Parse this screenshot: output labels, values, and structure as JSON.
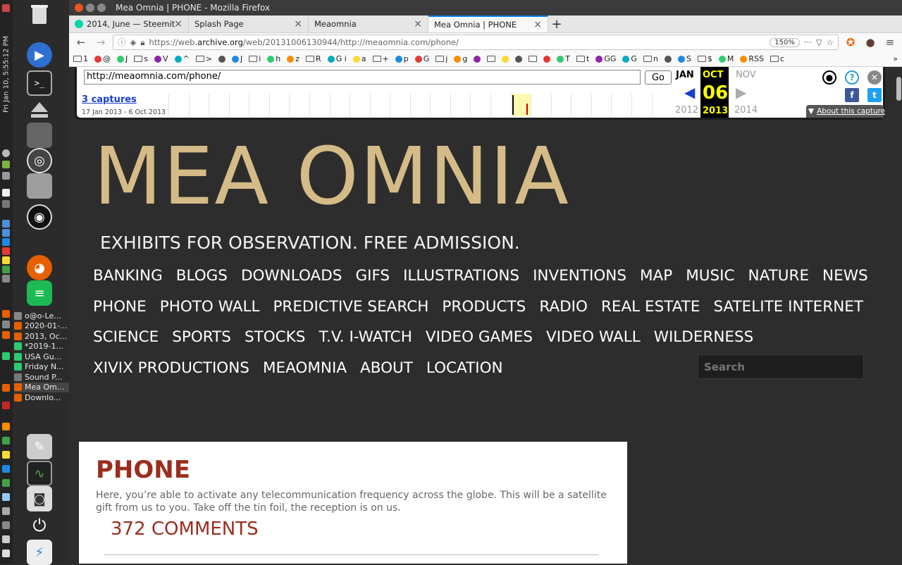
{
  "system": {
    "clock": "Fri Jan 10,  5:55:12 PM",
    "windows": [
      {
        "label": "o@o-Le...",
        "color": "#888"
      },
      {
        "label": "2020-01-...",
        "color": "#e66000"
      },
      {
        "label": "2013, Oc...",
        "color": "#e66000"
      },
      {
        "label": "*2019-1...",
        "color": "#2ecc71"
      },
      {
        "label": "USA Gu...",
        "color": "#2ecc71"
      },
      {
        "label": "Friday N...",
        "color": "#2ecc71"
      },
      {
        "label": "Sound P...",
        "color": "#777"
      },
      {
        "label": "Mea Om...",
        "color": "#e66000"
      },
      {
        "label": "Downlo...",
        "color": "#e66000"
      }
    ]
  },
  "window": {
    "title": "Mea Omnia | PHONE - Mozilla Firefox"
  },
  "tabs": [
    {
      "label": "2014, June — Steemit",
      "icon_color": "#06d6a9",
      "active": false
    },
    {
      "label": "Splash Page",
      "icon_color": "",
      "active": false
    },
    {
      "label": "Meaomnia",
      "icon_color": "",
      "active": false
    },
    {
      "label": "Mea Omnia | PHONE",
      "icon_color": "",
      "active": true
    }
  ],
  "address": {
    "prefix": "https://web.",
    "host": "archive.org",
    "path": "/web/20131006130944/http://meaomnia.com/phone/",
    "zoom": "150%"
  },
  "bookmarks": [
    "1",
    "@",
    "J",
    "s",
    "V",
    "^",
    ">",
    "",
    "J",
    "i",
    "h",
    "z",
    "R",
    "G i",
    "a",
    "+",
    "p",
    "G",
    "j",
    "g",
    "",
    "",
    "",
    "",
    "",
    "",
    "T",
    "t",
    "GG",
    "G",
    "n",
    "",
    "S",
    "$",
    "M",
    "RSS",
    "c"
  ],
  "wayback": {
    "url": "http://meaomnia.com/phone/",
    "go": "Go",
    "captures": "3 captures",
    "range": "17 Jan 2013 - 6 Oct 2013",
    "prev_month": "JAN",
    "cur_month": "OCT",
    "next_month": "NOV",
    "cur_day": "06",
    "prev_year": "2012",
    "cur_year": "2013",
    "next_year": "2014",
    "about": "About this capture"
  },
  "site": {
    "title": "MEA OMNIA",
    "tagline": "EXHIBITS FOR OBSERVATION. FREE ADMISSION.",
    "nav": [
      "BANKING",
      "BLOGS",
      "DOWNLOADS",
      "GIFS",
      "ILLUSTRATIONS",
      "INVENTIONS",
      "MAP",
      "MUSIC",
      "NATURE",
      "NEWS",
      "PHONE",
      "PHOTO WALL",
      "PREDICTIVE SEARCH",
      "PRODUCTS",
      "RADIO",
      "REAL ESTATE",
      "SATELITE INTERNET",
      "SCIENCE",
      "SPORTS",
      "STOCKS",
      "T.V. I-WATCH",
      "VIDEO GAMES",
      "VIDEO WALL",
      "WILDERNESS",
      "XIVIX PRODUCTIONS",
      "MEAOMNIA",
      "ABOUT",
      "LOCATION"
    ],
    "search_placeholder": "Search",
    "page_title": "PHONE",
    "body": "Here,  you’re able to activate any telecommunication frequency across the globe.  This will be a satellite gift from us to you.   Take off the tin foil, the reception is on us.",
    "comments": "372 COMMENTS"
  },
  "colors": {
    "title_gold": "#d4bb87",
    "heading_red": "#9b2d1f",
    "page_bg": "#2d2d2d"
  }
}
